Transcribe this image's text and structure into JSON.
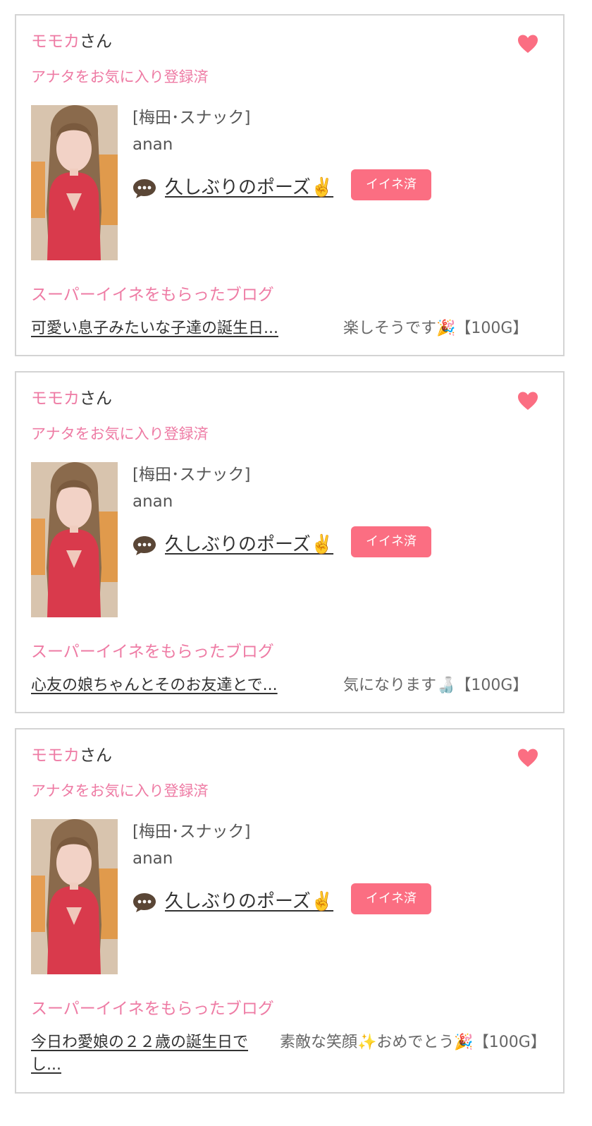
{
  "cards": [
    {
      "name": "モモカ",
      "suffix": "さん",
      "favorite_status": "アナタをお気に入り登録済",
      "shop": "[梅田･スナック]",
      "cast": "anan",
      "post_title": "久しぶりのポーズ✌️",
      "like_button": "イイネ済",
      "super_like_label": "スーパーイイネをもらったブログ",
      "blog_title": "可愛い息子みたいな子達の誕生日...",
      "comment": "楽しそうです🎉【100G】"
    },
    {
      "name": "モモカ",
      "suffix": "さん",
      "favorite_status": "アナタをお気に入り登録済",
      "shop": "[梅田･スナック]",
      "cast": "anan",
      "post_title": "久しぶりのポーズ✌️",
      "like_button": "イイネ済",
      "super_like_label": "スーパーイイネをもらったブログ",
      "blog_title": "心友の娘ちゃんとそのお友達とで...",
      "comment": "気になります🍶【100G】"
    },
    {
      "name": "モモカ",
      "suffix": "さん",
      "favorite_status": "アナタをお気に入り登録済",
      "shop": "[梅田･スナック]",
      "cast": "anan",
      "post_title": "久しぶりのポーズ✌️",
      "like_button": "イイネ済",
      "super_like_label": "スーパーイイネをもらったブログ",
      "blog_title": "今日わ愛娘の２２歳の誕生日でし...",
      "comment": "素敵な笑顔✨おめでとう🎉【100G】"
    }
  ],
  "icons": {
    "heart": "heart-icon",
    "bubble": "speech-bubble-icon"
  },
  "colors": {
    "accent_pink": "#ee7ba4",
    "heart": "#fb6e82",
    "like_button": "#fb6e82",
    "border": "#d4d4d4"
  }
}
